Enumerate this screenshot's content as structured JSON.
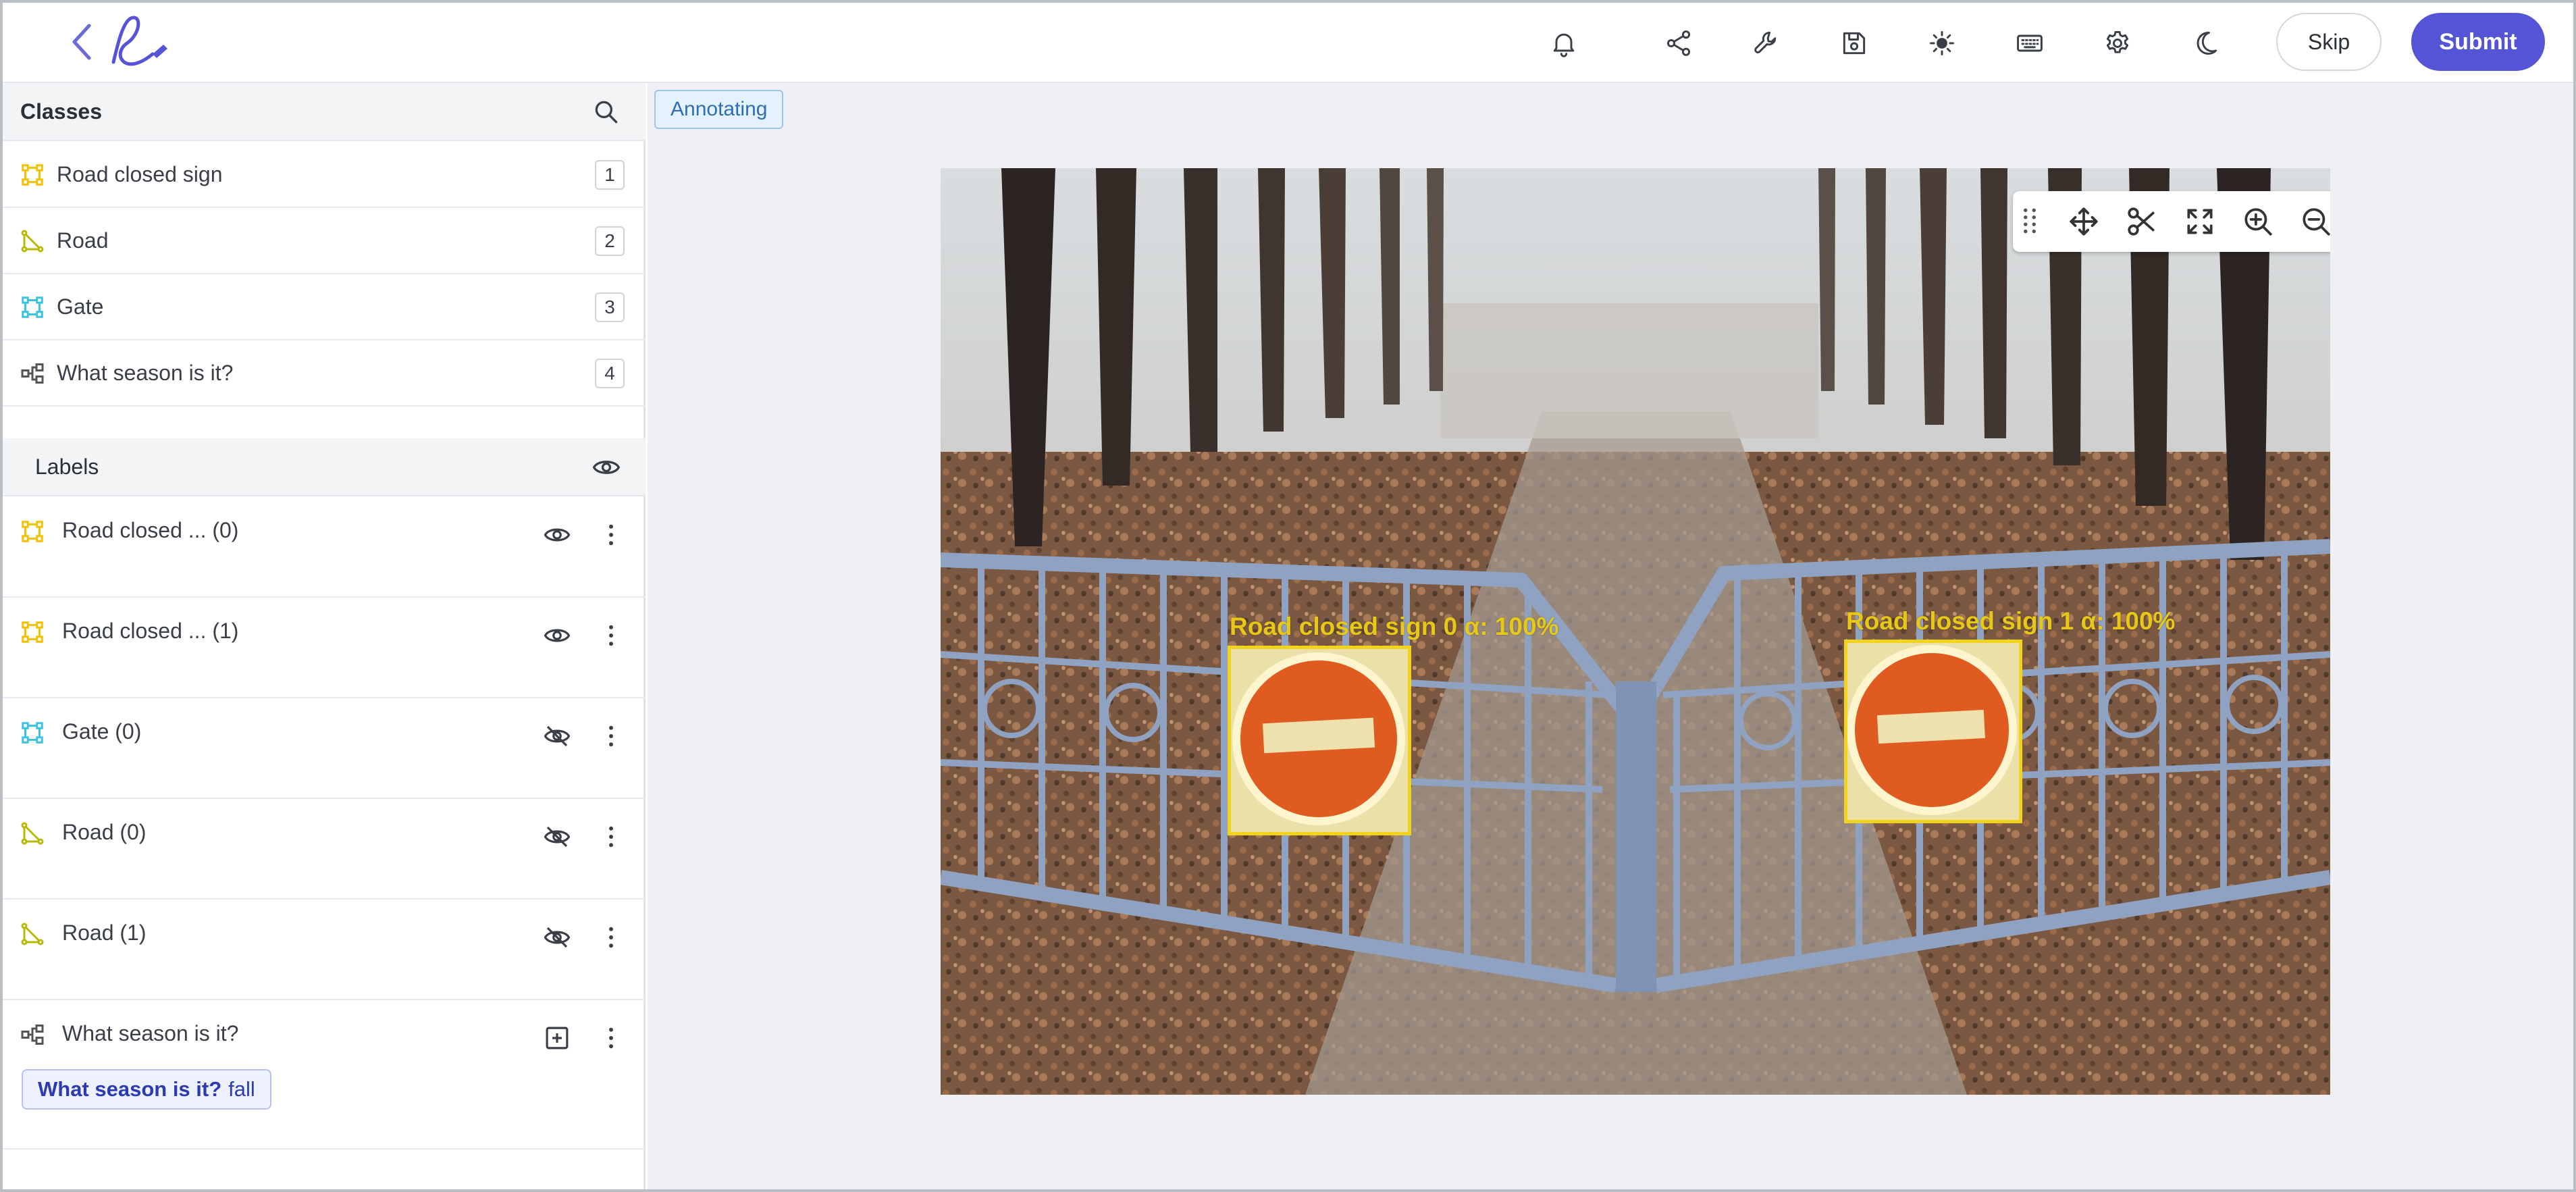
{
  "app": {
    "logo_icon": "signature-logo-icon",
    "toolbar_icons": [
      "bell-icon",
      "share-icon",
      "wrench-icon",
      "save-icon",
      "brightness-icon",
      "keyboard-icon",
      "gear-icon",
      "moon-icon"
    ],
    "skip_label": "Skip",
    "submit_label": "Submit",
    "accent_color": "#5654d6"
  },
  "classes": {
    "title": "Classes",
    "items": [
      {
        "name": "Road closed sign",
        "key": "1",
        "icon": "bbox-icon",
        "color": "#f2c200"
      },
      {
        "name": "Road",
        "key": "2",
        "icon": "polygon-icon",
        "color": "#b8b800"
      },
      {
        "name": "Gate",
        "key": "3",
        "icon": "bbox-icon",
        "color": "#3cc3e0"
      },
      {
        "name": "What season is it?",
        "key": "4",
        "icon": "classification-icon",
        "color": "#555555"
      }
    ]
  },
  "labels": {
    "title": "Labels",
    "items": [
      {
        "name": "Road closed ... (0)",
        "icon": "bbox-icon",
        "color": "#f2c200",
        "visible": true
      },
      {
        "name": "Road closed ... (1)",
        "icon": "bbox-icon",
        "color": "#f2c200",
        "visible": true
      },
      {
        "name": "Gate (0)",
        "icon": "bbox-icon",
        "color": "#3cc3e0",
        "visible": false
      },
      {
        "name": "Road (0)",
        "icon": "polygon-icon",
        "color": "#b8b800",
        "visible": false
      },
      {
        "name": "Road (1)",
        "icon": "polygon-icon",
        "color": "#b8b800",
        "visible": false
      },
      {
        "name": "What season is it?",
        "icon": "classification-icon",
        "color": "#555555"
      }
    ],
    "answer_question": "What season is it?",
    "answer_value": "fall"
  },
  "main": {
    "status": "Annotating",
    "canvas_tools": [
      "drag-handle-icon",
      "move-icon",
      "scissors-icon",
      "fit-screen-icon",
      "zoom-in-icon",
      "zoom-out-icon"
    ],
    "annotations": [
      {
        "label": "Road closed sign 0 α: 100%"
      },
      {
        "label": "Road closed sign 1 α: 100%"
      }
    ]
  }
}
